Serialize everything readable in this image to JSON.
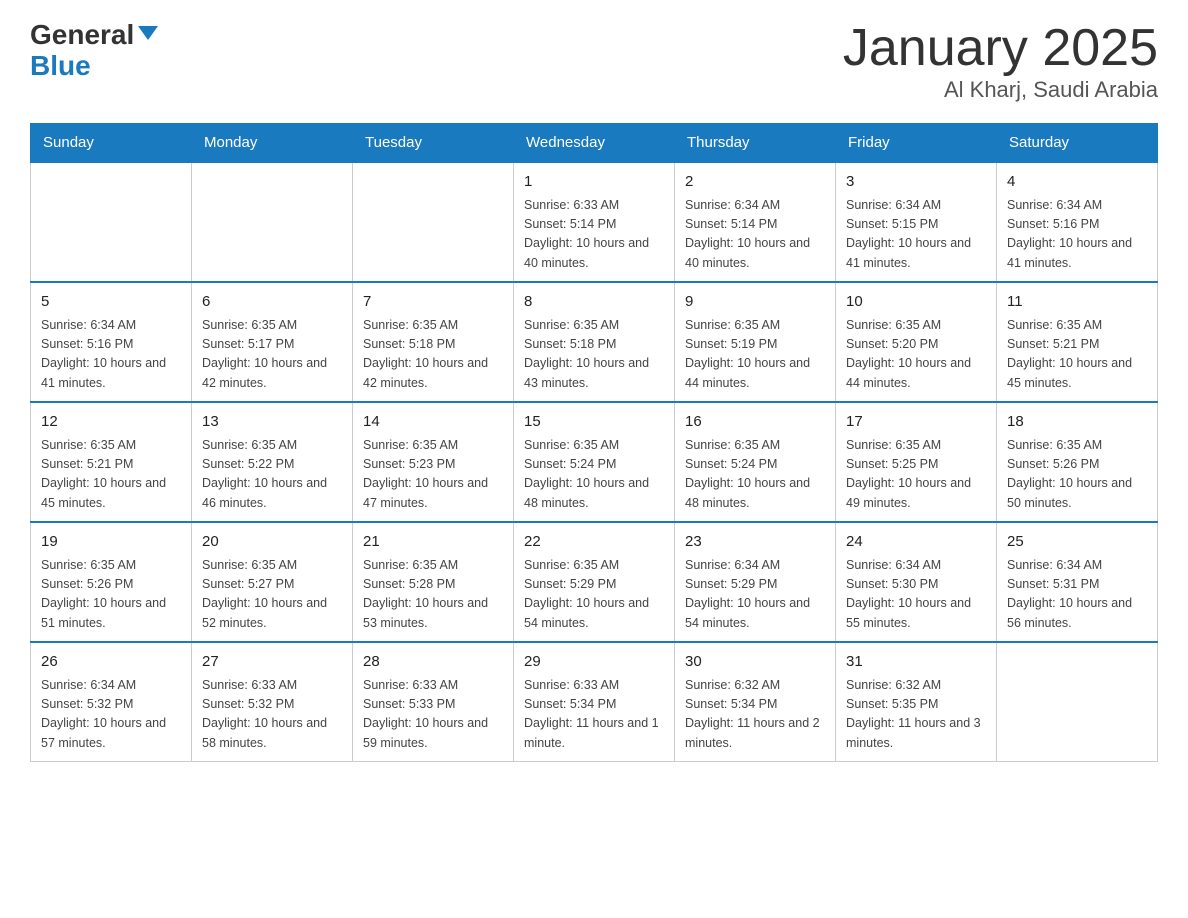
{
  "logo": {
    "text_general": "General",
    "text_blue": "Blue"
  },
  "title": "January 2025",
  "subtitle": "Al Kharj, Saudi Arabia",
  "days_of_week": [
    "Sunday",
    "Monday",
    "Tuesday",
    "Wednesday",
    "Thursday",
    "Friday",
    "Saturday"
  ],
  "weeks": [
    {
      "cells": [
        {
          "empty": true
        },
        {
          "empty": true
        },
        {
          "empty": true
        },
        {
          "day": 1,
          "sunrise": "6:33 AM",
          "sunset": "5:14 PM",
          "daylight": "10 hours and 40 minutes."
        },
        {
          "day": 2,
          "sunrise": "6:34 AM",
          "sunset": "5:14 PM",
          "daylight": "10 hours and 40 minutes."
        },
        {
          "day": 3,
          "sunrise": "6:34 AM",
          "sunset": "5:15 PM",
          "daylight": "10 hours and 41 minutes."
        },
        {
          "day": 4,
          "sunrise": "6:34 AM",
          "sunset": "5:16 PM",
          "daylight": "10 hours and 41 minutes."
        }
      ]
    },
    {
      "cells": [
        {
          "day": 5,
          "sunrise": "6:34 AM",
          "sunset": "5:16 PM",
          "daylight": "10 hours and 41 minutes."
        },
        {
          "day": 6,
          "sunrise": "6:35 AM",
          "sunset": "5:17 PM",
          "daylight": "10 hours and 42 minutes."
        },
        {
          "day": 7,
          "sunrise": "6:35 AM",
          "sunset": "5:18 PM",
          "daylight": "10 hours and 42 minutes."
        },
        {
          "day": 8,
          "sunrise": "6:35 AM",
          "sunset": "5:18 PM",
          "daylight": "10 hours and 43 minutes."
        },
        {
          "day": 9,
          "sunrise": "6:35 AM",
          "sunset": "5:19 PM",
          "daylight": "10 hours and 44 minutes."
        },
        {
          "day": 10,
          "sunrise": "6:35 AM",
          "sunset": "5:20 PM",
          "daylight": "10 hours and 44 minutes."
        },
        {
          "day": 11,
          "sunrise": "6:35 AM",
          "sunset": "5:21 PM",
          "daylight": "10 hours and 45 minutes."
        }
      ]
    },
    {
      "cells": [
        {
          "day": 12,
          "sunrise": "6:35 AM",
          "sunset": "5:21 PM",
          "daylight": "10 hours and 45 minutes."
        },
        {
          "day": 13,
          "sunrise": "6:35 AM",
          "sunset": "5:22 PM",
          "daylight": "10 hours and 46 minutes."
        },
        {
          "day": 14,
          "sunrise": "6:35 AM",
          "sunset": "5:23 PM",
          "daylight": "10 hours and 47 minutes."
        },
        {
          "day": 15,
          "sunrise": "6:35 AM",
          "sunset": "5:24 PM",
          "daylight": "10 hours and 48 minutes."
        },
        {
          "day": 16,
          "sunrise": "6:35 AM",
          "sunset": "5:24 PM",
          "daylight": "10 hours and 48 minutes."
        },
        {
          "day": 17,
          "sunrise": "6:35 AM",
          "sunset": "5:25 PM",
          "daylight": "10 hours and 49 minutes."
        },
        {
          "day": 18,
          "sunrise": "6:35 AM",
          "sunset": "5:26 PM",
          "daylight": "10 hours and 50 minutes."
        }
      ]
    },
    {
      "cells": [
        {
          "day": 19,
          "sunrise": "6:35 AM",
          "sunset": "5:26 PM",
          "daylight": "10 hours and 51 minutes."
        },
        {
          "day": 20,
          "sunrise": "6:35 AM",
          "sunset": "5:27 PM",
          "daylight": "10 hours and 52 minutes."
        },
        {
          "day": 21,
          "sunrise": "6:35 AM",
          "sunset": "5:28 PM",
          "daylight": "10 hours and 53 minutes."
        },
        {
          "day": 22,
          "sunrise": "6:35 AM",
          "sunset": "5:29 PM",
          "daylight": "10 hours and 54 minutes."
        },
        {
          "day": 23,
          "sunrise": "6:34 AM",
          "sunset": "5:29 PM",
          "daylight": "10 hours and 54 minutes."
        },
        {
          "day": 24,
          "sunrise": "6:34 AM",
          "sunset": "5:30 PM",
          "daylight": "10 hours and 55 minutes."
        },
        {
          "day": 25,
          "sunrise": "6:34 AM",
          "sunset": "5:31 PM",
          "daylight": "10 hours and 56 minutes."
        }
      ]
    },
    {
      "cells": [
        {
          "day": 26,
          "sunrise": "6:34 AM",
          "sunset": "5:32 PM",
          "daylight": "10 hours and 57 minutes."
        },
        {
          "day": 27,
          "sunrise": "6:33 AM",
          "sunset": "5:32 PM",
          "daylight": "10 hours and 58 minutes."
        },
        {
          "day": 28,
          "sunrise": "6:33 AM",
          "sunset": "5:33 PM",
          "daylight": "10 hours and 59 minutes."
        },
        {
          "day": 29,
          "sunrise": "6:33 AM",
          "sunset": "5:34 PM",
          "daylight": "11 hours and 1 minute."
        },
        {
          "day": 30,
          "sunrise": "6:32 AM",
          "sunset": "5:34 PM",
          "daylight": "11 hours and 2 minutes."
        },
        {
          "day": 31,
          "sunrise": "6:32 AM",
          "sunset": "5:35 PM",
          "daylight": "11 hours and 3 minutes."
        },
        {
          "empty": true
        }
      ]
    }
  ]
}
